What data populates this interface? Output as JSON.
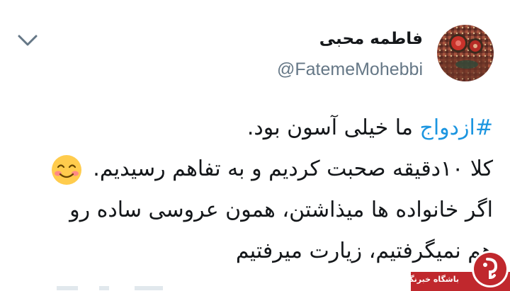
{
  "author": {
    "display_name": "فاطمه محبی",
    "handle": "@FatemeMohebbi"
  },
  "tweet": {
    "hashtag_symbol": "#",
    "hashtag_text": "ازدواج",
    "line1_rest": " ما خیلی آسون بود.",
    "line2": "کلا ۱۰دقیقه صحبت کردیم و به تفاهم رسیدیم.",
    "line3": "اگر خانواده ها میذاشتن، همون عروسی ساده رو",
    "line4": "هم نمیگرفتیم، زیارت میرفتیم",
    "emoji": "smiling-face-with-smiling-eyes"
  },
  "watermark": {
    "text": "باشگاه خبرنگاران"
  },
  "colors": {
    "link": "#1b95e0",
    "text": "#14171a",
    "secondary": "#657786",
    "watermark": "#c0282d"
  }
}
